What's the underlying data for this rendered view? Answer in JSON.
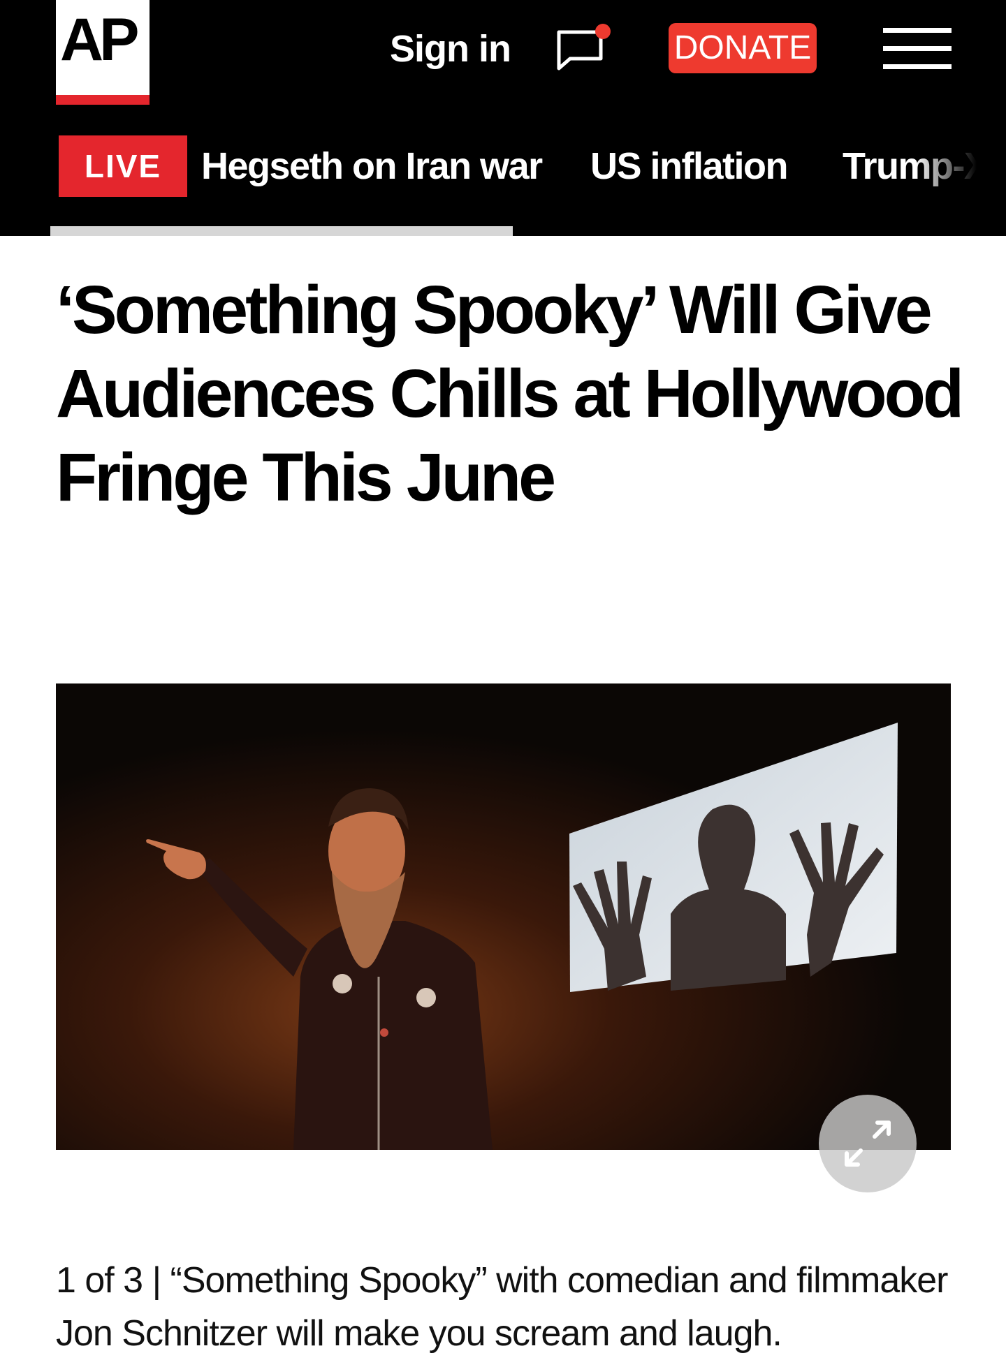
{
  "header": {
    "logo_text": "AP",
    "sign_in_label": "Sign in",
    "notification_icon": "chat-bubble-icon",
    "donate_label": "DONATE",
    "menu_icon": "hamburger-menu-icon",
    "colors": {
      "background": "#000000",
      "brand_red": "#e4262d",
      "donate": "#ee3a2f",
      "notification_dot": "#ee3a2f"
    }
  },
  "ticker": {
    "live_label": "LIVE",
    "items": [
      "Hegseth on Iran war",
      "US inflation",
      "Trump-X"
    ]
  },
  "article": {
    "headline": "‘Something Spooky’ Will Give Audiences Chills at Hollywood Fringe This June",
    "gallery": {
      "counter": "1 of 3",
      "separator": "|",
      "caption": "“Something Spooky” with comedian and filmmaker Jon Schnitzer will make you scream and laugh.",
      "expand_icon": "expand-arrows-icon"
    }
  }
}
